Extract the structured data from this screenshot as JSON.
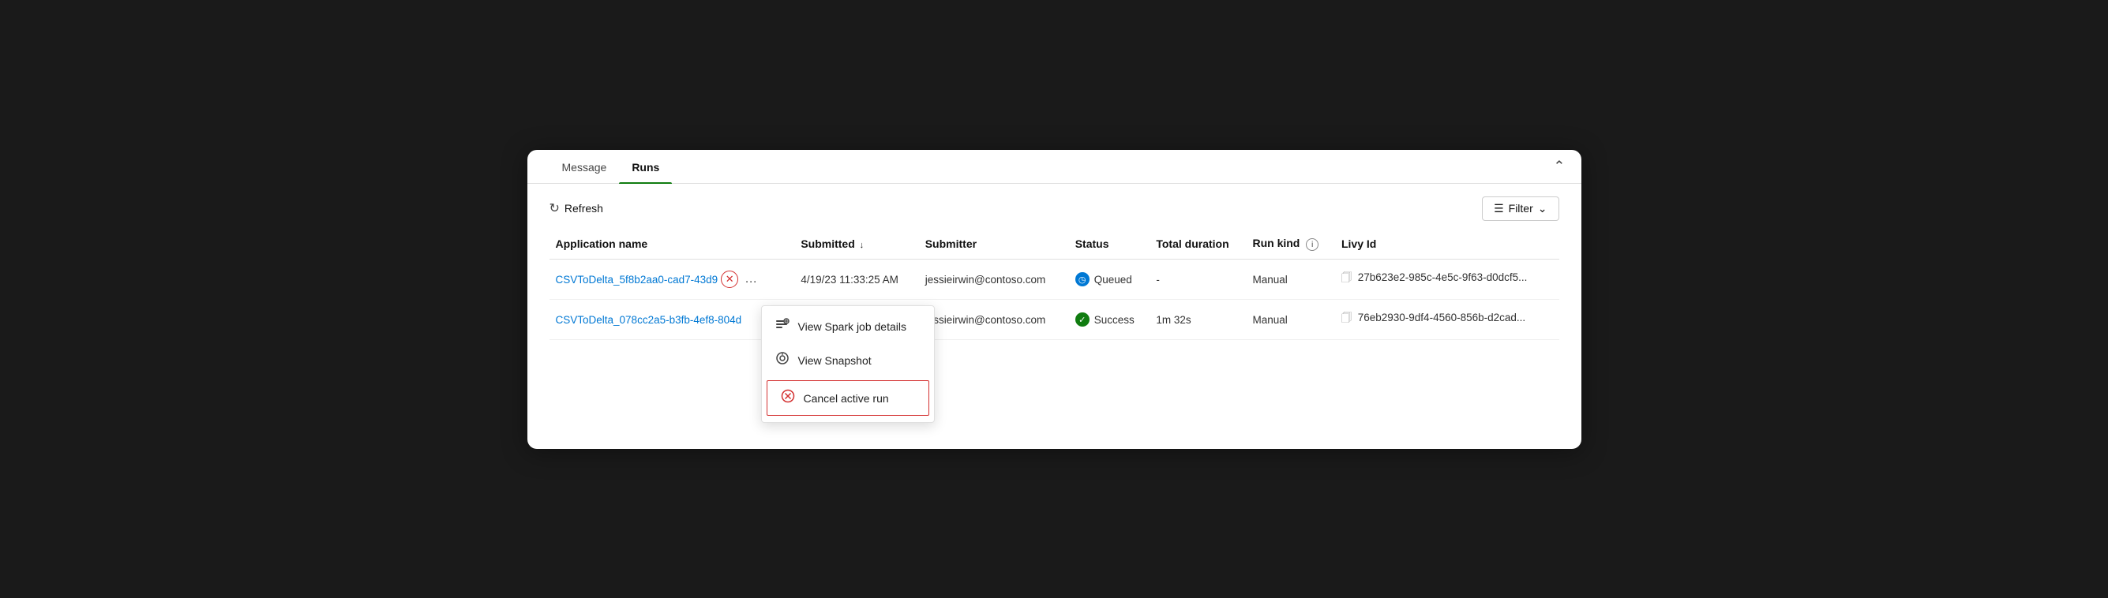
{
  "tabs": [
    {
      "id": "message",
      "label": "Message",
      "active": false
    },
    {
      "id": "runs",
      "label": "Runs",
      "active": true
    }
  ],
  "toolbar": {
    "refresh_label": "Refresh",
    "filter_label": "Filter"
  },
  "table": {
    "columns": [
      {
        "id": "app_name",
        "label": "Application name"
      },
      {
        "id": "submitted",
        "label": "Submitted",
        "sortable": true,
        "sort_dir": "↓"
      },
      {
        "id": "submitter",
        "label": "Submitter"
      },
      {
        "id": "status",
        "label": "Status"
      },
      {
        "id": "duration",
        "label": "Total duration"
      },
      {
        "id": "run_kind",
        "label": "Run kind",
        "info": true
      },
      {
        "id": "livy_id",
        "label": "Livy Id"
      }
    ],
    "rows": [
      {
        "app_name": "CSVToDelta_5f8b2aa0-cad7-43d9",
        "submitted": "4/19/23 11:33:25 AM",
        "submitter": "jessieirwin@contoso.com",
        "status": "Queued",
        "status_type": "queued",
        "duration": "-",
        "run_kind": "Manual",
        "livy_id": "27b623e2-985c-4e5c-9f63-d0dcf5...",
        "show_context_menu": true
      },
      {
        "app_name": "CSVToDelta_078cc2a5-b3fb-4ef8-804d",
        "submitted": "",
        "submitter": "jessieirwin@contoso.com",
        "status": "Success",
        "status_type": "success",
        "duration": "1m 32s",
        "run_kind": "Manual",
        "livy_id": "76eb2930-9df4-4560-856b-d2cad...",
        "show_context_menu": false
      }
    ]
  },
  "context_menu": {
    "items": [
      {
        "id": "view-spark",
        "label": "View Spark job details",
        "icon": "spark"
      },
      {
        "id": "view-snapshot",
        "label": "View Snapshot",
        "icon": "snapshot"
      }
    ],
    "cancel": {
      "id": "cancel-run",
      "label": "Cancel active run"
    }
  }
}
